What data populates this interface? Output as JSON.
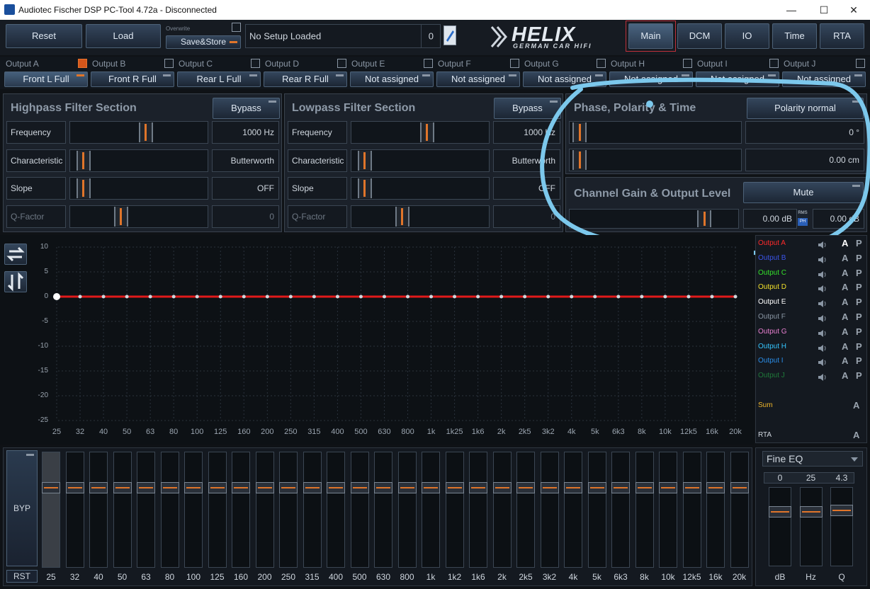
{
  "window": {
    "title": "Audiotec Fischer DSP PC-Tool 4.72a - Disconnected",
    "minimize": "—",
    "maximize": "☐",
    "close": "✕"
  },
  "toolbar": {
    "reset": "Reset",
    "load": "Load",
    "overwrite": "Overwrite",
    "save_store": "Save&Store",
    "setup_name": "No Setup Loaded",
    "setup_number": "0",
    "logo_main": "HELIX",
    "logo_sub": "GERMAN CAR HIFI"
  },
  "nav": [
    {
      "label": "Main"
    },
    {
      "label": "DCM"
    },
    {
      "label": "IO"
    },
    {
      "label": "Time"
    },
    {
      "label": "RTA"
    }
  ],
  "outputs": [
    {
      "label": "Output A",
      "assign": "Front L Full",
      "checked": true
    },
    {
      "label": "Output B",
      "assign": "Front R Full",
      "checked": false
    },
    {
      "label": "Output C",
      "assign": "Rear L Full",
      "checked": false
    },
    {
      "label": "Output D",
      "assign": "Rear R Full",
      "checked": false
    },
    {
      "label": "Output E",
      "assign": "Not assigned",
      "checked": false
    },
    {
      "label": "Output F",
      "assign": "Not assigned",
      "checked": false
    },
    {
      "label": "Output G",
      "assign": "Not assigned",
      "checked": false
    },
    {
      "label": "Output H",
      "assign": "Not assigned",
      "checked": false
    },
    {
      "label": "Output I",
      "assign": "Not assigned",
      "checked": false
    },
    {
      "label": "Output J",
      "assign": "Not assigned",
      "checked": false
    }
  ],
  "highpass": {
    "title": "Highpass Filter Section",
    "bypass": "Bypass",
    "rows": [
      {
        "label": "Frequency",
        "value": "1000 Hz",
        "level": 0.55
      },
      {
        "label": "Characteristic",
        "value": "Butterworth",
        "level": 0.05
      },
      {
        "label": "Slope",
        "value": "OFF",
        "level": 0.05
      },
      {
        "label": "Q-Factor",
        "value": "0",
        "level": 0.35
      }
    ]
  },
  "lowpass": {
    "title": "Lowpass Filter Section",
    "bypass": "Bypass",
    "rows": [
      {
        "label": "Frequency",
        "value": "1000 Hz",
        "level": 0.55
      },
      {
        "label": "Characteristic",
        "value": "Butterworth",
        "level": 0.05
      },
      {
        "label": "Slope",
        "value": "OFF",
        "level": 0.05
      },
      {
        "label": "Q-Factor",
        "value": "0",
        "level": 0.35
      }
    ]
  },
  "phase": {
    "title": "Phase, Polarity & Time",
    "polarity": "Polarity normal",
    "phase_value": "0 °",
    "phase_level": 0.02,
    "time_value": "0.00 cm",
    "time_level": 0.02
  },
  "gain": {
    "title": "Channel Gain & Output Level",
    "mute": "Mute",
    "gain_value": "0.00 dB",
    "level_value": "0.00 dB",
    "level": 0.82,
    "rms": "RMS",
    "ph": "PH"
  },
  "graph": {
    "y_ticks": [
      "10",
      "5",
      "0",
      "-5",
      "-10",
      "-15",
      "-20",
      "-25"
    ],
    "x_ticks": [
      "25",
      "32",
      "40",
      "50",
      "63",
      "80",
      "100",
      "125",
      "160",
      "200",
      "250",
      "315",
      "400",
      "500",
      "630",
      "800",
      "1k",
      "1k25",
      "1k6",
      "2k",
      "2k5",
      "3k2",
      "4k",
      "5k",
      "6k3",
      "8k",
      "10k",
      "12k5",
      "16k",
      "20k"
    ],
    "ymin": -25,
    "ymax": 10,
    "curve_db": 0
  },
  "legend": [
    {
      "label": "Output A",
      "color": "#ff2a2a"
    },
    {
      "label": "Output B",
      "color": "#3b54e8"
    },
    {
      "label": "Output C",
      "color": "#34e02a"
    },
    {
      "label": "Output D",
      "color": "#f2e12a"
    },
    {
      "label": "Output E",
      "color": "#ffffff"
    },
    {
      "label": "Output F",
      "color": "#8a96a4"
    },
    {
      "label": "Output G",
      "color": "#e87fd0"
    },
    {
      "label": "Output H",
      "color": "#35c6ff"
    },
    {
      "label": "Output I",
      "color": "#2a8de8"
    },
    {
      "label": "Output J",
      "color": "#1f7a3a"
    }
  ],
  "legend_a": "A",
  "legend_p": "P",
  "sum": "Sum",
  "rta": "RTA",
  "eq": {
    "byp": "BYP",
    "rst": "RST",
    "bands": [
      "25",
      "32",
      "40",
      "50",
      "63",
      "80",
      "100",
      "125",
      "160",
      "200",
      "250",
      "315",
      "400",
      "500",
      "630",
      "800",
      "1k",
      "1k2",
      "1k6",
      "2k",
      "2k5",
      "3k2",
      "4k",
      "5k",
      "6k3",
      "8k",
      "10k",
      "12k5",
      "16k",
      "20k"
    ]
  },
  "fine": {
    "mode": "Fine EQ",
    "values": [
      "0",
      "25",
      "4.3"
    ],
    "labels": [
      "dB",
      "Hz",
      "Q"
    ]
  },
  "colors": {
    "accent": "#e0752a",
    "annotation": "#7cc8ec",
    "curve": "#e01a1a"
  }
}
